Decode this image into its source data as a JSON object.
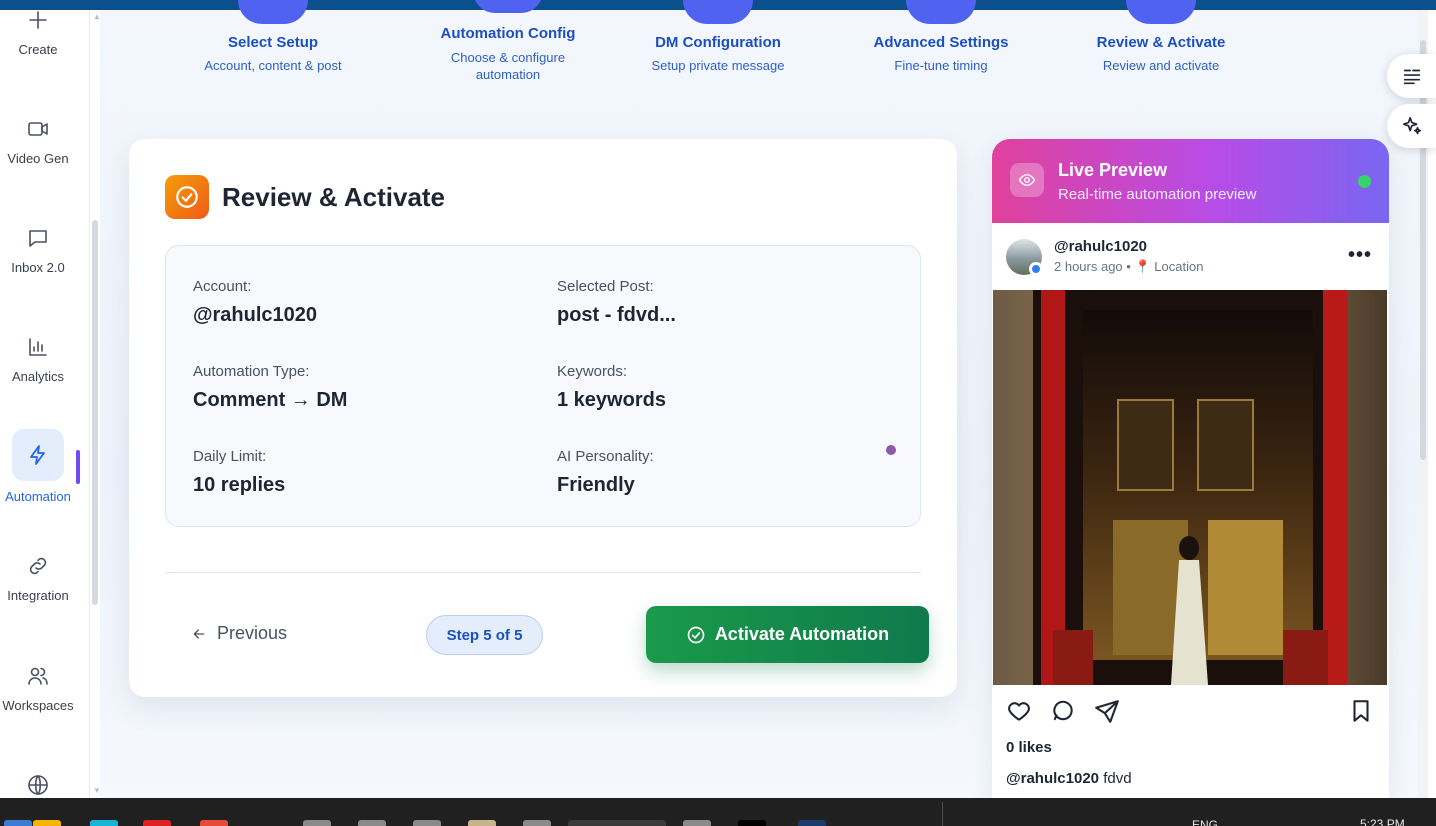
{
  "sidebar": {
    "items": [
      {
        "label": "Create",
        "icon": "plus-icon"
      },
      {
        "label": "Video Gen",
        "icon": "video-icon"
      },
      {
        "label": "Inbox 2.0",
        "icon": "chat-icon"
      },
      {
        "label": "Analytics",
        "icon": "bar-chart-icon"
      },
      {
        "label": "Automation",
        "icon": "bolt-icon",
        "active": true
      },
      {
        "label": "Integration",
        "icon": "link-icon"
      },
      {
        "label": "Workspaces",
        "icon": "users-icon"
      },
      {
        "label": "",
        "icon": "globe-icon"
      }
    ]
  },
  "steps": [
    {
      "title": "Select Setup",
      "subtitle": "Account, content & post"
    },
    {
      "title": "Automation Config",
      "subtitle": "Choose & configure automation"
    },
    {
      "title": "DM Configuration",
      "subtitle": "Setup private message"
    },
    {
      "title": "Advanced Settings",
      "subtitle": "Fine-tune timing"
    },
    {
      "title": "Review & Activate",
      "subtitle": "Review and activate"
    }
  ],
  "review": {
    "title": "Review & Activate",
    "fields": {
      "account": {
        "label": "Account:",
        "value": "@rahulc1020"
      },
      "post": {
        "label": "Selected Post:",
        "value": "post - fdvd..."
      },
      "type": {
        "label": "Automation Type:",
        "value": "Comment → DM"
      },
      "keywords": {
        "label": "Keywords:",
        "value": "1 keywords"
      },
      "limit": {
        "label": "Daily Limit:",
        "value": "10 replies"
      },
      "personality": {
        "label": "AI Personality:",
        "value": "Friendly"
      }
    },
    "previous_label": "Previous",
    "step_indicator": "Step 5 of 5",
    "activate_label": "Activate Automation"
  },
  "preview": {
    "title": "Live Preview",
    "subtitle": "Real-time automation preview",
    "username": "@rahulc1020",
    "time": "2 hours ago",
    "separator": "•",
    "location": "📍 Location",
    "likes": "0 likes",
    "caption_user": "@rahulc1020",
    "caption_text": "fdvd"
  },
  "taskbar": {
    "lang": "ENG",
    "time": "5:23 PM"
  },
  "colors": {
    "accent": "#2563eb",
    "activate_green": "#1a9a4a",
    "preview_gradient_start": "#e0419c",
    "preview_gradient_end": "#7a66f2"
  }
}
